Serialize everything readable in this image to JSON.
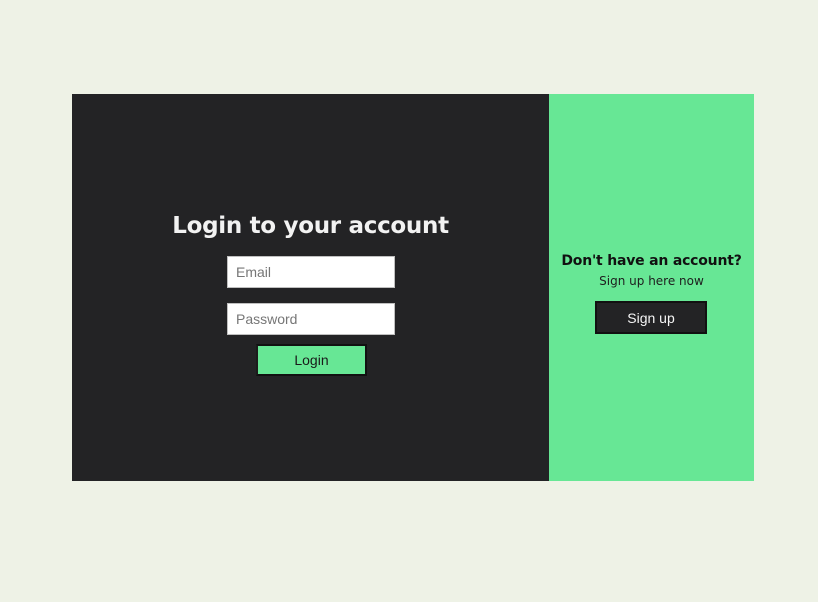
{
  "login": {
    "title": "Login to your account",
    "email_placeholder": "Email",
    "password_placeholder": "Password",
    "login_label": "Login"
  },
  "signup": {
    "title": "Don't have an account?",
    "subtitle": "Sign up here now",
    "signup_label": "Sign up"
  },
  "colors": {
    "background": "#eef2e6",
    "dark_panel": "#232325",
    "accent_green": "#67e795"
  }
}
